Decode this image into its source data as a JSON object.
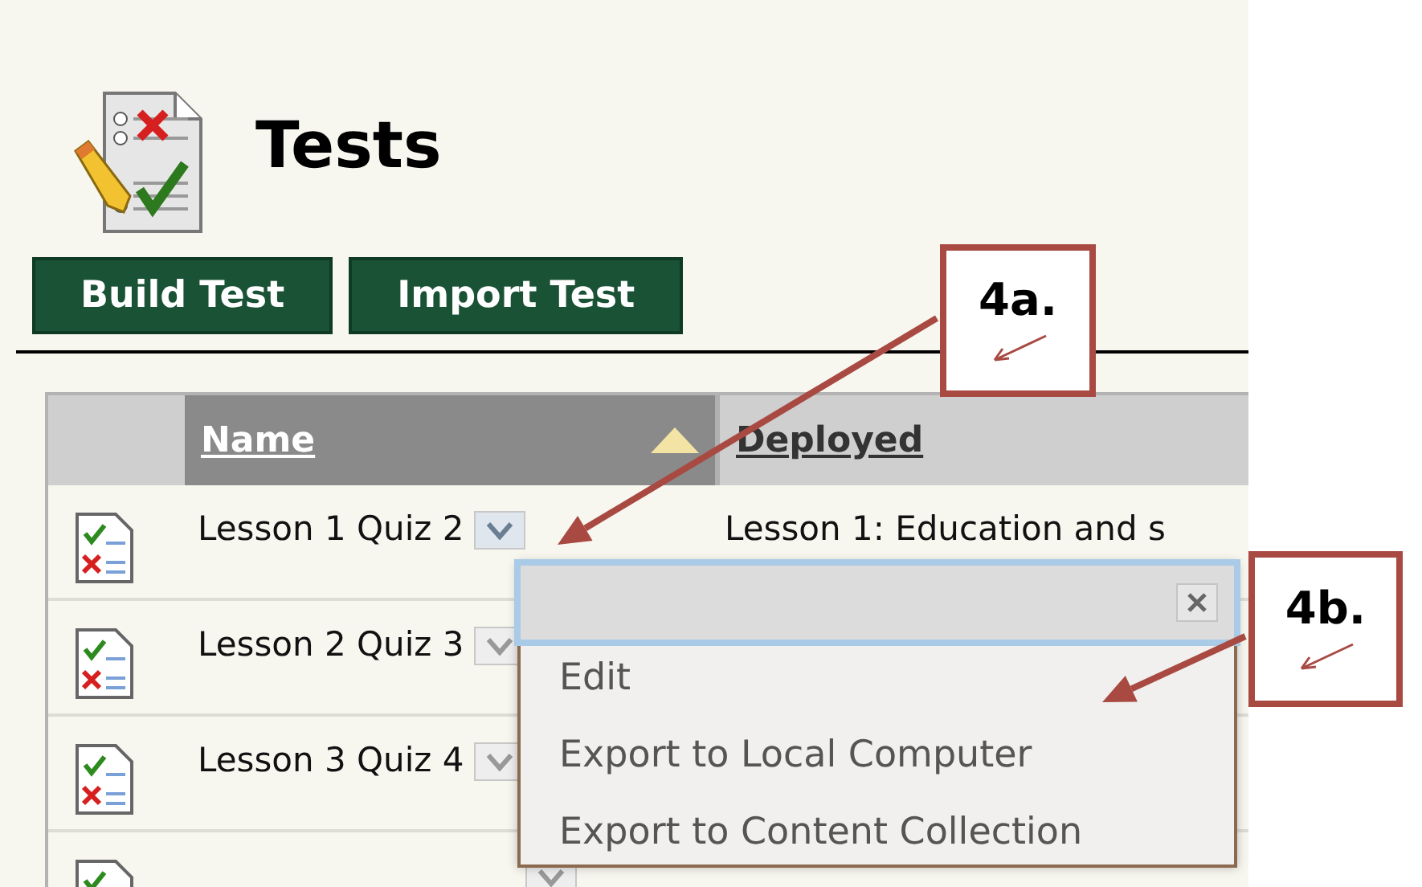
{
  "page": {
    "title": "Tests"
  },
  "buttons": [
    "Build Test",
    "Import Test"
  ],
  "table": {
    "columns": [
      {
        "label": "Name",
        "sorted": true
      },
      {
        "label": "Deployed",
        "sorted": false
      }
    ],
    "rows": [
      {
        "name": "Lesson 1 Quiz 2",
        "deployed": "Lesson 1: Education and s",
        "menu_open": true
      },
      {
        "name": "Lesson 2 Quiz 3",
        "menu_open": false
      },
      {
        "name": "Lesson 3 Quiz 4",
        "menu_open": false
      },
      {
        "menu_open": false
      }
    ]
  },
  "context_menu": {
    "items": [
      "Edit",
      "Export to Local Computer",
      "Export to Content Collection"
    ]
  },
  "annotations": [
    {
      "label": "4a."
    },
    {
      "label": "4b."
    }
  ]
}
